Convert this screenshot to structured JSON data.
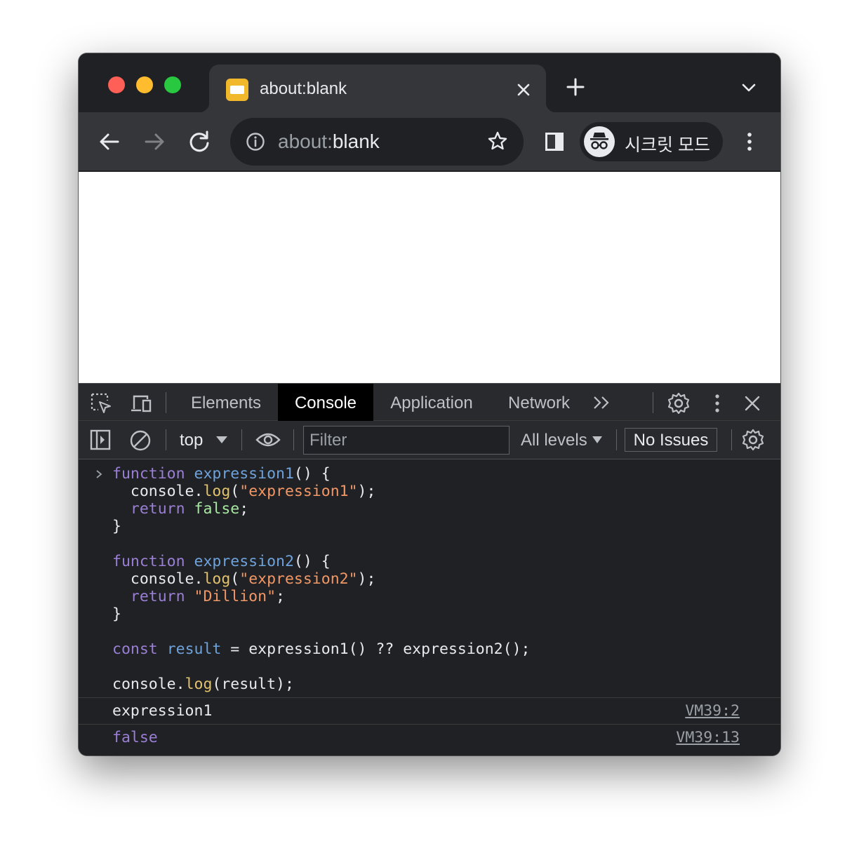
{
  "tab": {
    "title": "about:blank",
    "close_icon": "close-icon"
  },
  "omnibox": {
    "url_dim": "about:",
    "url_main": "blank"
  },
  "profile": {
    "label": "시크릿 모드"
  },
  "devtools": {
    "tabs": [
      "Elements",
      "Console",
      "Application",
      "Network"
    ],
    "active_tab": "Console",
    "context": "top",
    "filter_placeholder": "Filter",
    "levels": "All levels",
    "issues": "No Issues"
  },
  "console": {
    "code": {
      "l1_kw": "function",
      "l1_fn": "expression1",
      "l1_rest": "() {",
      "l2_obj": "  console.",
      "l2_meth": "log",
      "l2_open": "(",
      "l2_str": "\"expression1\"",
      "l2_close": ");",
      "l3_kw": "  return",
      "l3_val": "false",
      "l3_end": ";",
      "l4": "}",
      "l6_kw": "function",
      "l6_fn": "expression2",
      "l6_rest": "() {",
      "l7_obj": "  console.",
      "l7_meth": "log",
      "l7_open": "(",
      "l7_str": "\"expression2\"",
      "l7_close": ");",
      "l8_kw": "  return",
      "l8_str": "\"Dillion\"",
      "l8_end": ";",
      "l9": "}",
      "l11_kw": "const",
      "l11_var": "result",
      "l11_rest": " = expression1() ?? expression2();",
      "l13_obj": "console.",
      "l13_meth": "log",
      "l13_rest": "(result);"
    },
    "messages": [
      {
        "text": "expression1",
        "source": "VM39:2"
      },
      {
        "text": "false",
        "source": "VM39:13"
      }
    ]
  },
  "colors": {
    "traffic_red": "#fe5f57",
    "traffic_yellow": "#febc2e",
    "traffic_green": "#28c840",
    "keyword": "#9a7fd5",
    "string": "#f29766",
    "method": "#e3c26d",
    "boolean": "#a8e6a3"
  }
}
